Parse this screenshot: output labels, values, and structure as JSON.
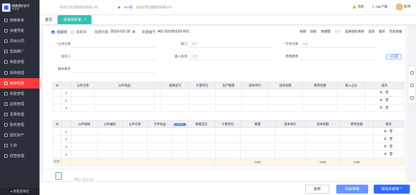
{
  "app": {
    "logo_text": "畅捷通好会计",
    "logo_sub": "专业版"
  },
  "sidebar": {
    "items": [
      {
        "label": "搜索菜单",
        "active": false
      },
      {
        "label": "快捷导航",
        "active": false
      },
      {
        "label": "项目合同",
        "active": false
      },
      {
        "label": "营销推广",
        "active": false
      },
      {
        "label": "销售管理",
        "active": false
      },
      {
        "label": "采购管理",
        "active": false
      },
      {
        "label": "库存核算",
        "active": true
      },
      {
        "label": "资金管理",
        "active": false
      },
      {
        "label": "总账管理",
        "active": false
      },
      {
        "label": "发票管理",
        "active": false
      },
      {
        "label": "税务管理",
        "active": false
      },
      {
        "label": "固定资产",
        "active": false
      },
      {
        "label": "工资",
        "active": false
      },
      {
        "label": "经营管理",
        "active": false
      }
    ],
    "footer": "收起菜单栏"
  },
  "topbar": {
    "breadcrumb": "好会计专业版股份有限公司",
    "company": "好会计专业版股份有限公司",
    "badge": "VSA版",
    "company2": "好会计专业版股份有限公司",
    "actions": [
      {
        "label": "消息"
      },
      {
        "label": "App下载"
      },
      {
        "label": "陈伟"
      }
    ]
  },
  "tabs": [
    {
      "label": "首页",
      "active": false
    },
    {
      "label": "组装拆卸单",
      "active": true
    }
  ],
  "doc": {
    "mode_assemble": "组装单",
    "mode_disassemble": "拆卸单",
    "date_label": "单据日期",
    "date_value": "2023-03-18",
    "number_label": "单据编号",
    "number_value": "AD-20230318-001",
    "toolbar": [
      {
        "label": "视频",
        "dim": false
      },
      {
        "label": "帮助",
        "dim": false
      },
      {
        "label": "快捷键",
        "dim": false
      },
      {
        "label": "打印",
        "dim": true
      },
      {
        "label": "选择组料清单",
        "dim": false
      },
      {
        "label": "选单",
        "dim": false
      },
      {
        "label": "操作",
        "dim": false
      },
      {
        "label": "历史单据",
        "dim": false
      }
    ]
  },
  "form": {
    "parent_warehouse": {
      "label": "父件仓库",
      "required": true,
      "placeholder": ""
    },
    "department": {
      "label": "部门",
      "required": false,
      "placeholder": "请选"
    },
    "child_warehouse": {
      "label": "子件仓库",
      "required": true,
      "placeholder": "请选"
    },
    "handler": {
      "label": "经手人",
      "required": false,
      "placeholder": ""
    },
    "income_subject": {
      "label": "收入会项",
      "required": false,
      "placeholder": "选择"
    },
    "fee_item": {
      "label": "费用费用",
      "required": false,
      "placeholder": ""
    },
    "custom_field": {
      "label": "摘本要开",
      "required": false,
      "placeholder": ""
    },
    "settings_button": "设置"
  },
  "table_parent": {
    "columns": [
      "",
      "",
      "父件仓库",
      "父件商品",
      "",
      "规格型号",
      "计量单位",
      "生产数量",
      "成本单价",
      "成本金额",
      "费用金额",
      "收入占比",
      "操作"
    ],
    "rows": [
      {
        "idx": "1"
      },
      {
        "idx": "2"
      },
      {
        "idx": "3"
      }
    ]
  },
  "table_child": {
    "columns": [
      "",
      "",
      "父件规格",
      "父件编码",
      "父件名称",
      "子件商品",
      "扫码录入",
      "规格型号",
      "计量单位",
      "数量",
      "成本单价",
      "成本金额",
      "费用金额",
      "操作"
    ],
    "rows": [
      {
        "idx": "1"
      },
      {
        "idx": "2"
      },
      {
        "idx": "3"
      },
      {
        "idx": "4"
      }
    ],
    "summary": {
      "label": "小计",
      "qty": "0.00",
      "amount": "0.00",
      "fee": "0.00"
    }
  },
  "remark": {
    "placeholder": "请输入备注信息"
  },
  "footer": {
    "discard": "放弃",
    "save": "保存草稿",
    "save_new": "保存并新增"
  }
}
